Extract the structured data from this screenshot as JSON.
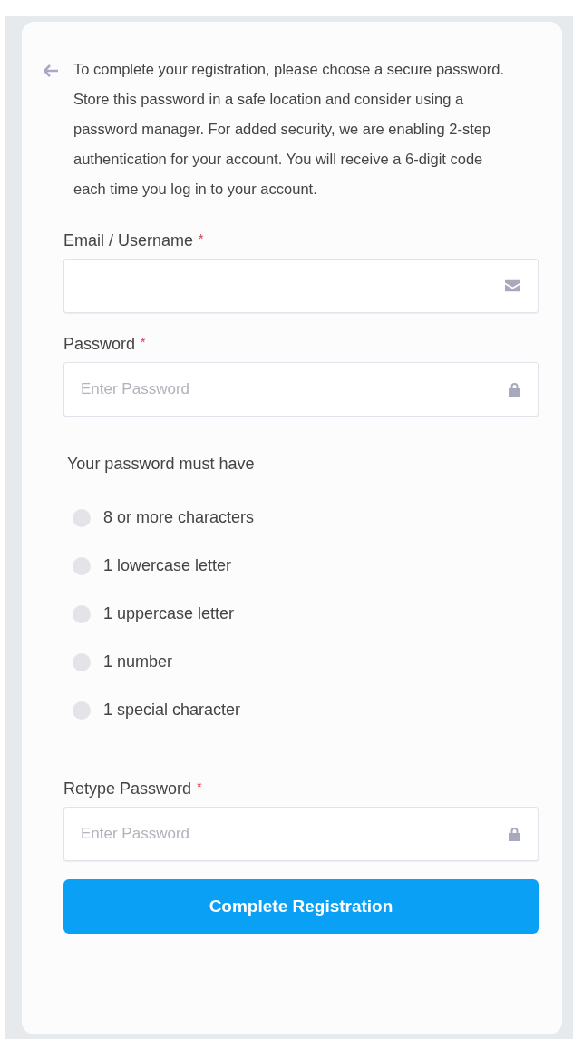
{
  "intro": {
    "text": "To complete your registration, please choose a secure password. Store this password in a safe location and consider using a password manager. For added security, we are enabling 2-step authentication for your account. You will receive a 6-digit code each time you log in to your account."
  },
  "fields": [
    {
      "label": "Email / Username",
      "required_mark": "*",
      "kind": "email"
    },
    {
      "label": "Password",
      "required_mark": "*",
      "kind": "password",
      "placeholder": "Enter Password"
    }
  ],
  "requirements": {
    "title": "Your password must have",
    "items": [
      {
        "text": "8 or more characters",
        "met": false
      },
      {
        "text": "1 lowercase letter",
        "met": false
      },
      {
        "text": "1 uppercase letter",
        "met": false
      },
      {
        "text": "1 number",
        "met": false
      },
      {
        "text": "1 special character",
        "met": false
      }
    ]
  },
  "retype": {
    "label": "Retype Password",
    "required_mark": "*",
    "kind": "password",
    "placeholder": "Enter Password"
  },
  "submit": {
    "label": "Complete Registration"
  }
}
